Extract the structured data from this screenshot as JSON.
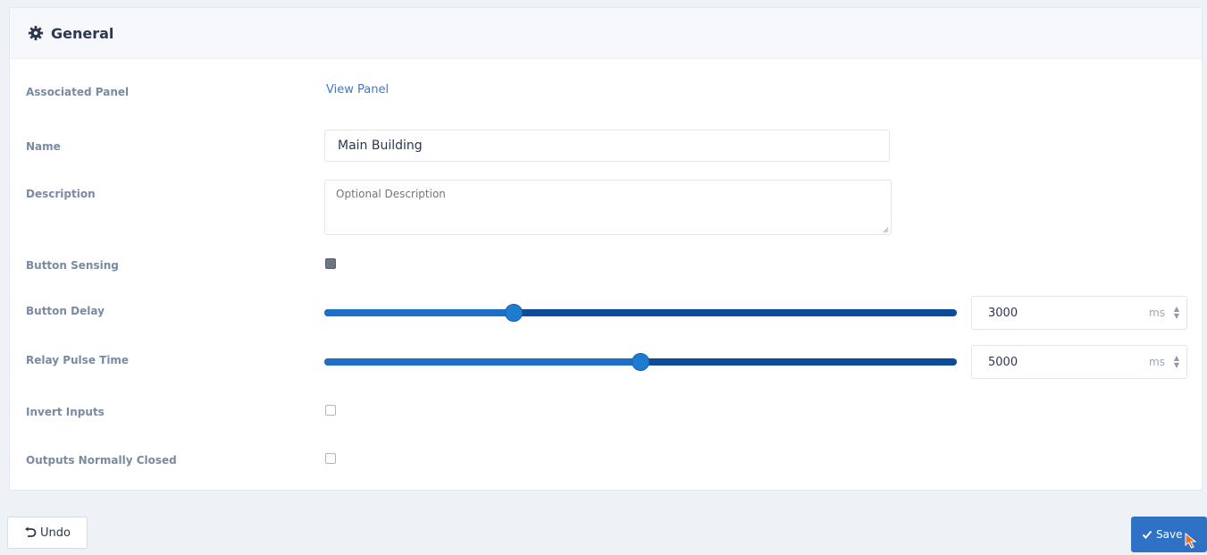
{
  "header": {
    "title": "General",
    "icon": "gear-icon"
  },
  "fields": {
    "associated_panel": {
      "label": "Associated Panel",
      "link": "View Panel"
    },
    "name": {
      "label": "Name",
      "value": "Main Building"
    },
    "description": {
      "label": "Description",
      "placeholder": "Optional Description",
      "value": ""
    },
    "button_sensing": {
      "label": "Button Sensing",
      "checked": true
    },
    "button_delay": {
      "label": "Button Delay",
      "value": "3000",
      "unit": "ms",
      "fraction": 0.3
    },
    "relay_pulse_time": {
      "label": "Relay Pulse Time",
      "value": "5000",
      "unit": "ms",
      "fraction": 0.5
    },
    "invert_inputs": {
      "label": "Invert Inputs",
      "checked": false
    },
    "outputs_normally_closed": {
      "label": "Outputs Normally Closed",
      "checked": false
    }
  },
  "footer": {
    "undo_label": "Undo",
    "save_label": "Save"
  },
  "colors": {
    "accent": "#2f72c5",
    "slider_track": "#0c4a9a",
    "link": "#3a7bd5"
  }
}
